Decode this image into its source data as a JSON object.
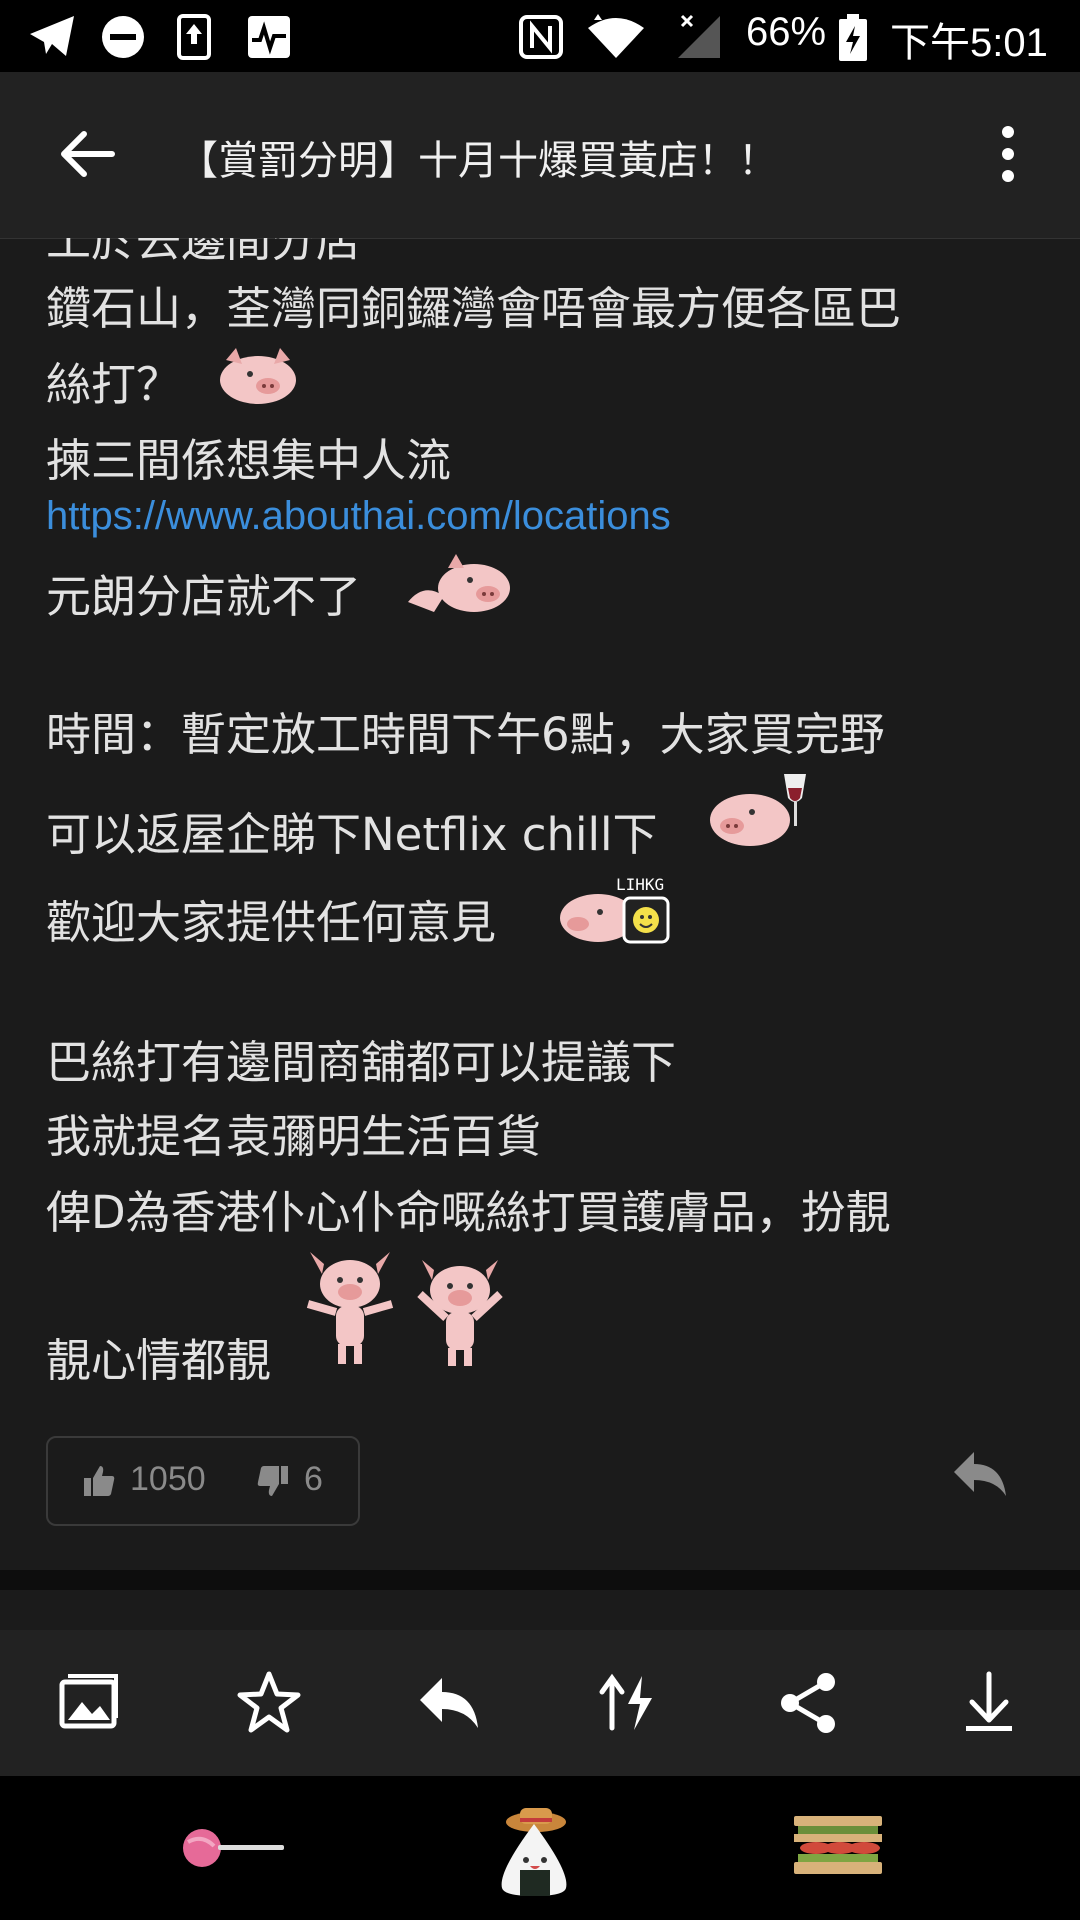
{
  "status_bar": {
    "battery": "66%",
    "time": "下午5:01",
    "icons": [
      "telegram-icon",
      "dnd-icon",
      "upload-icon",
      "pulse-icon",
      "nfc-icon",
      "wifi-icon",
      "signal-icon",
      "battery-charging-icon"
    ]
  },
  "app_bar": {
    "title": "【賞罰分明】十月十爆買黃店！！",
    "icons": [
      "back-arrow-icon",
      "more-vert-icon"
    ]
  },
  "post": {
    "line_cut": "工於去邊間分店",
    "line1": "鑽石山，荃灣同銅鑼灣會唔會最方便各區巴",
    "line2": "絲打？",
    "line3": "揀三間係想集中人流",
    "link": "https://www.abouthai.com/locations",
    "line4": "元朗分店就不了",
    "line5": "時間：暫定放工時間下午6點，大家買完野",
    "line6": "可以返屋企睇下Netflix chill下",
    "line7": "歡迎大家提供任何意見",
    "line8": "巴絲打有邊間商舖都可以提議下",
    "line9": "我就提名袁彌明生活百貨",
    "line10": "俾D為香港仆心仆命嘅絲打買護膚品，扮靚",
    "line11": "靚心情都靚",
    "sticker_text": "LIHKG"
  },
  "votes": {
    "up": "1050",
    "down": "6"
  },
  "toolbar": [
    "image-icon",
    "star-icon",
    "reply-icon",
    "sort-icon",
    "share-icon",
    "download-icon"
  ],
  "bottom_nav": [
    "lollipop-icon",
    "onigiri-icon",
    "sandwich-icon"
  ],
  "colors": {
    "bg": "#1b1b1b",
    "bar": "#222222",
    "link": "#3b8edc",
    "pig": "#f3c6c6"
  }
}
